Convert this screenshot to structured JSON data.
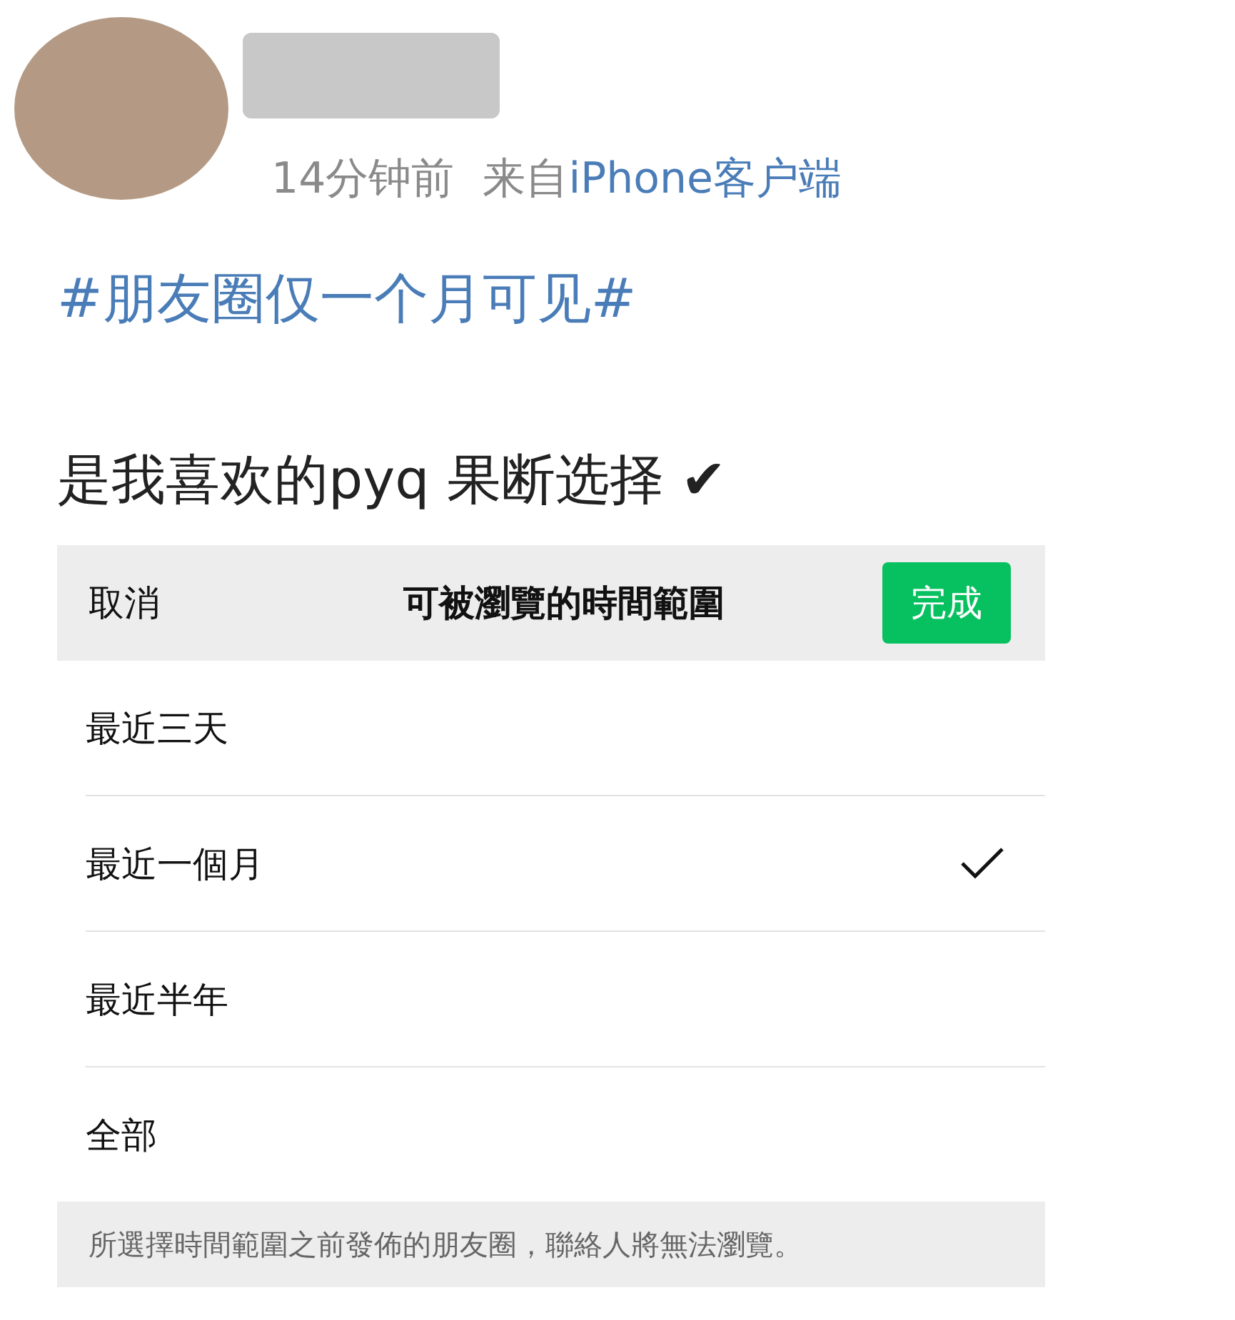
{
  "post": {
    "time": "14分钟前",
    "source_prefix": "来自",
    "source": "iPhone客户端",
    "hashtag": "#朋友圈仅一个月可见#",
    "text": "是我喜欢的pyq 果断选择 ✔"
  },
  "sheet": {
    "cancel": "取消",
    "title": "可被瀏覽的時間範圍",
    "done": "完成",
    "options": [
      {
        "label": "最近三天",
        "selected": false
      },
      {
        "label": "最近一個月",
        "selected": true
      },
      {
        "label": "最近半年",
        "selected": false
      },
      {
        "label": "全部",
        "selected": false
      }
    ],
    "footnote": "所選擇時間範圍之前發佈的朋友圈，聯絡人將無法瀏覽。"
  }
}
